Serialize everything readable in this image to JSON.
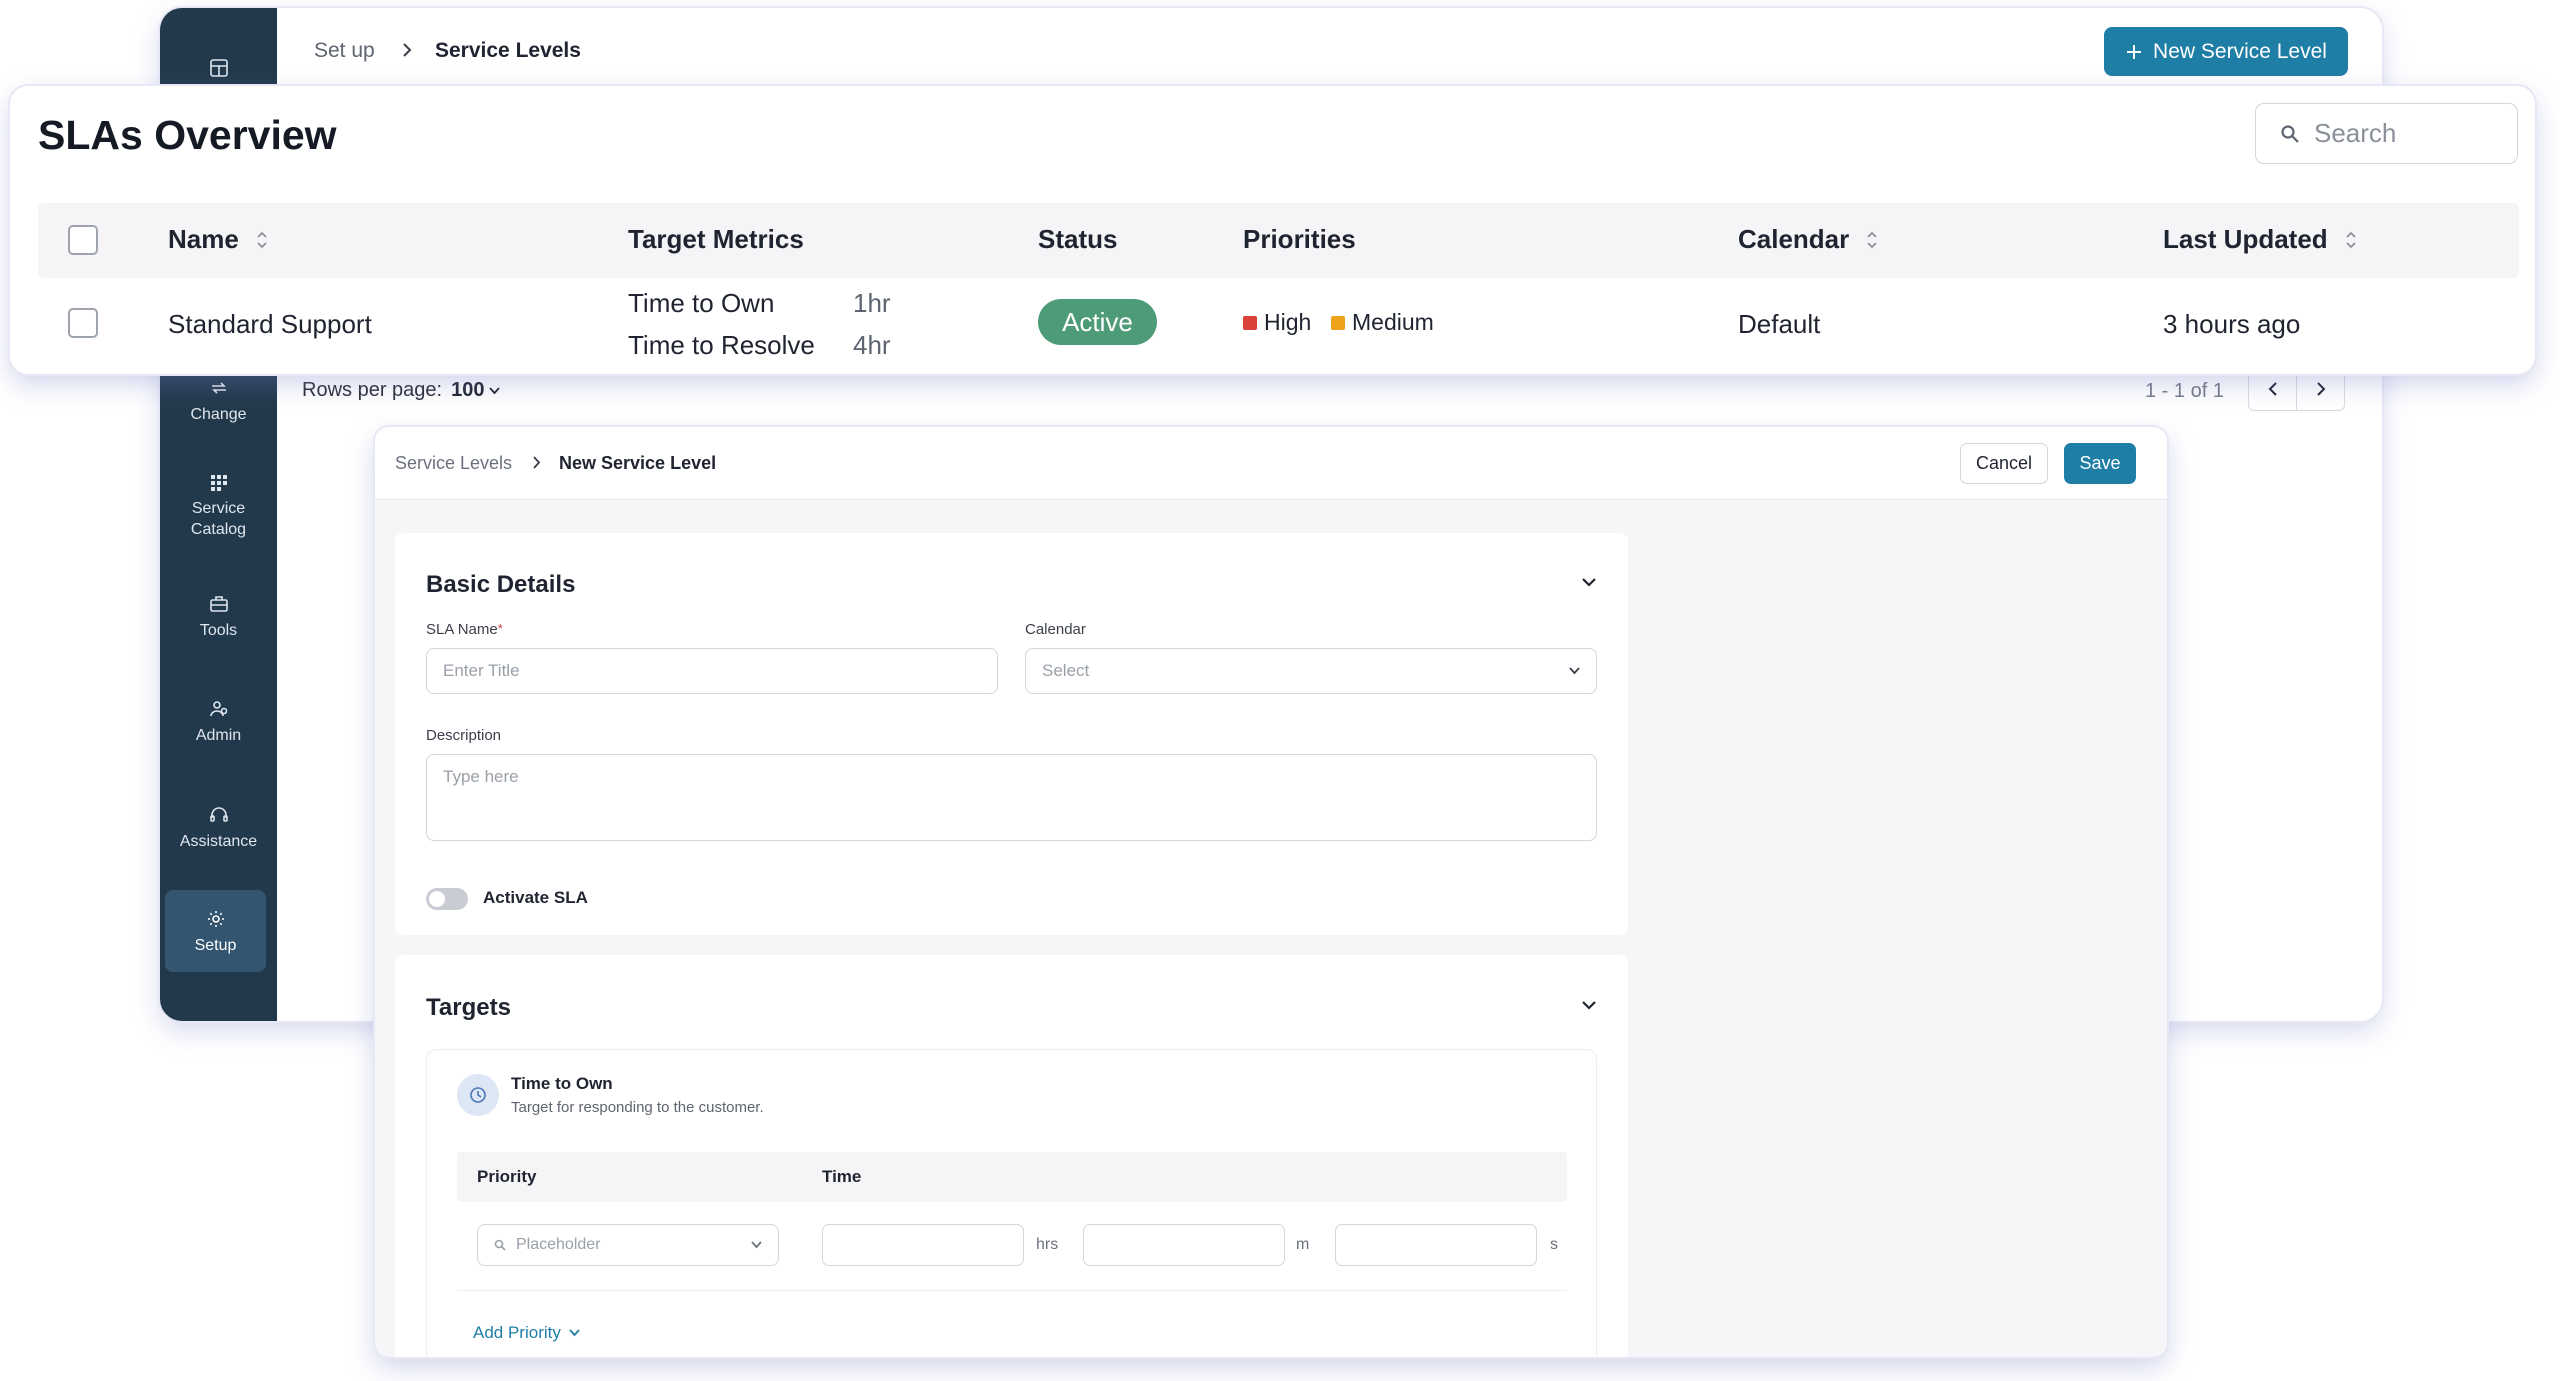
{
  "app": {
    "breadcrumb": {
      "parent": "Set up",
      "current": "Service Levels"
    },
    "new_service_level_label": "New Service Level",
    "sidebar": {
      "items": [
        {
          "label": "Change",
          "icon": "repeat-icon"
        },
        {
          "label": "Service\nCatalog",
          "icon": "grid-icon"
        },
        {
          "label": "Tools",
          "icon": "toolbox-icon"
        },
        {
          "label": "Admin",
          "icon": "users-icon"
        },
        {
          "label": "Assistance",
          "icon": "headset-icon"
        },
        {
          "label": "Setup",
          "icon": "gear-icon"
        }
      ]
    },
    "rows_per_page": {
      "label": "Rows per page:",
      "value": "100"
    },
    "pagination": {
      "info": "1 - 1 of 1"
    }
  },
  "overview": {
    "title": "SLAs Overview",
    "search": {
      "placeholder": "Search"
    },
    "columns": {
      "name": "Name",
      "target_metrics": "Target Metrics",
      "status": "Status",
      "priorities": "Priorities",
      "calendar": "Calendar",
      "last_updated": "Last Updated"
    },
    "rows": [
      {
        "name": "Standard Support",
        "metrics": [
          {
            "label": "Time to Own",
            "value": "1hr"
          },
          {
            "label": "Time to Resolve",
            "value": "4hr"
          }
        ],
        "status": "Active",
        "priorities": [
          {
            "label": "High",
            "color": "#d9413a"
          },
          {
            "label": "Medium",
            "color": "#eda21b"
          }
        ],
        "calendar": "Default",
        "last_updated": "3 hours ago"
      }
    ]
  },
  "form": {
    "breadcrumb": {
      "parent": "Service Levels",
      "current": "New Service Level"
    },
    "cancel_label": "Cancel",
    "save_label": "Save",
    "basic_details": {
      "title": "Basic Details",
      "sla_name": {
        "label": "SLA Name",
        "required_mark": "*",
        "placeholder": "Enter Title"
      },
      "calendar": {
        "label": "Calendar",
        "placeholder": "Select"
      },
      "description": {
        "label": "Description",
        "placeholder": "Type here"
      },
      "activate_label": "Activate SLA"
    },
    "targets": {
      "title": "Targets",
      "time_to_own": {
        "title": "Time to Own",
        "description": "Target for responding to the customer.",
        "priority_header": "Priority",
        "time_header": "Time",
        "priority_placeholder": "Placeholder",
        "units": {
          "hours": "hrs",
          "minutes": "m",
          "seconds": "s"
        },
        "add_priority_label": "Add Priority"
      }
    }
  },
  "colors": {
    "sidebar_bg": "#22394c",
    "primary": "#1f7ea5",
    "status_active": "#4e9b77"
  }
}
